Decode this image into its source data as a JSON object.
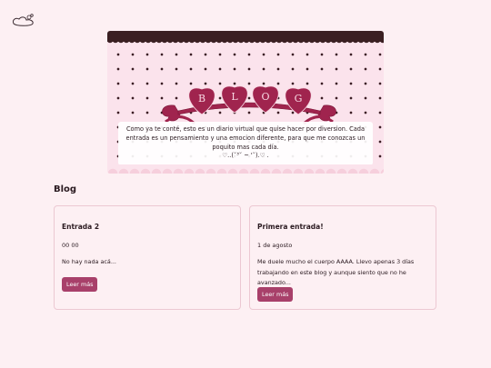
{
  "banner": {
    "heart_letters": [
      "B",
      "L",
      "O",
      "G"
    ],
    "description": "Como ya te conté, esto es un diario virtual que quise hacer por diversion. Cada entrada es un pensamiento y una emocion diferente, para que me conozcas un poquito mas cada día.",
    "kaomoji": "♡..(˘³˘ ~ '˘).♡ ."
  },
  "section": {
    "title": "Blog"
  },
  "posts": [
    {
      "title": "Entrada 2",
      "date": "00 00",
      "excerpt": "No hay nada acá...",
      "button_label": "Leer más"
    },
    {
      "title": "Primera entrada!",
      "date": "1 de agosto",
      "excerpt": "Me duele mucho el cuerpo AAAA. Llevo apenas 3 días trabajando en este blog y aunque siento que no he avanzado...",
      "button_label": "Leer más"
    }
  ],
  "colors": {
    "background": "#fdf0f3",
    "accent": "#a8406a",
    "heart": "#a0244e",
    "lace": "#3b1f22"
  }
}
